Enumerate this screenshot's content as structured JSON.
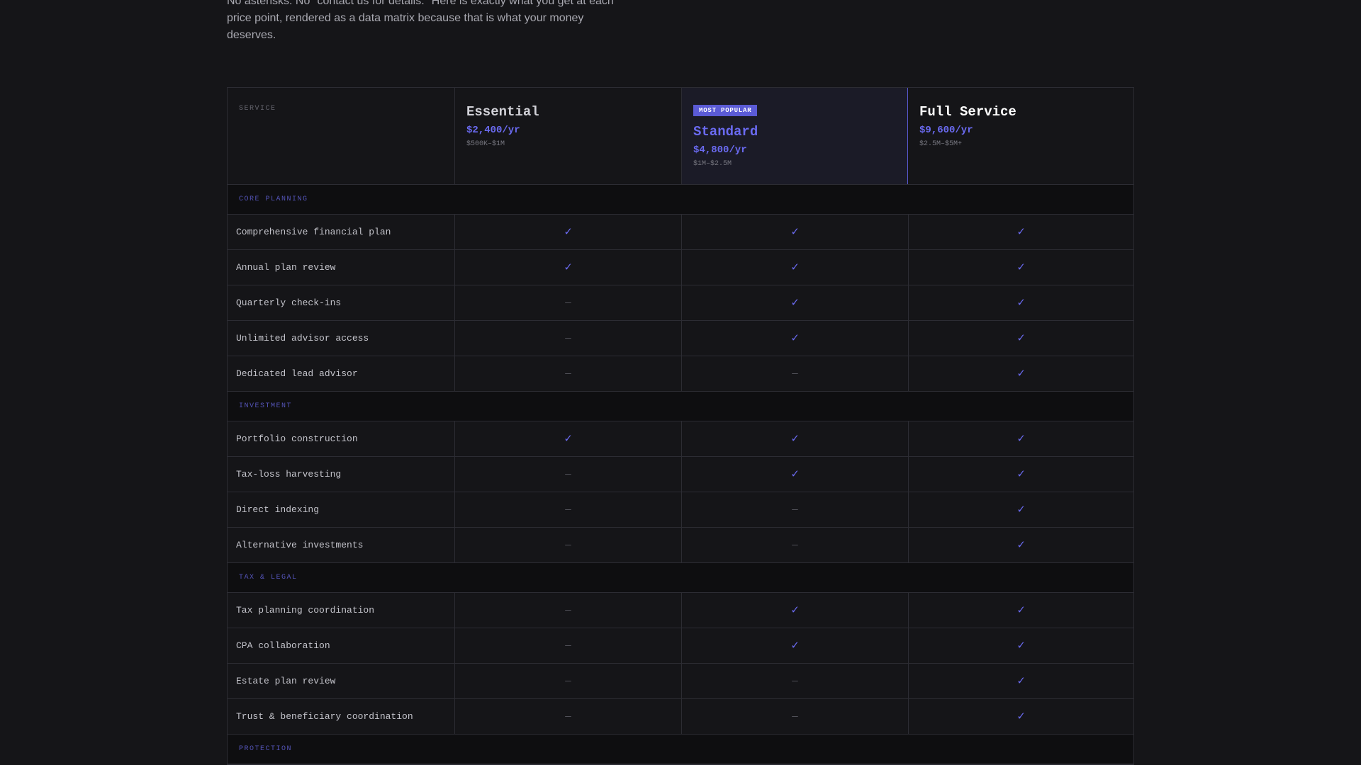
{
  "intro": {
    "text": "No asterisks. No \"contact us for details.\" Here is exactly what you get at each price point, rendered as a data matrix because that is what your money deserves."
  },
  "header": {
    "service_label": "SERVICE",
    "tiers": [
      {
        "name": "Essential",
        "price": "$2,400/yr",
        "range": "$500K–$1M"
      },
      {
        "name": "Standard",
        "price": "$4,800/yr",
        "range": "$1M–$2.5M",
        "badge": "MOST POPULAR"
      },
      {
        "name": "Full Service",
        "price": "$9,600/yr",
        "range": "$2.5M–$5M+"
      }
    ]
  },
  "marks": {
    "yes": "✓",
    "no": "—"
  },
  "colors": {
    "accent": "#5b5bd6",
    "background": "#151518",
    "section_background": "#0e0e10"
  },
  "sections": [
    {
      "label": "CORE PLANNING",
      "rows": [
        {
          "feature": "Comprehensive financial plan",
          "values": [
            true,
            true,
            true
          ]
        },
        {
          "feature": "Annual plan review",
          "values": [
            true,
            true,
            true
          ]
        },
        {
          "feature": "Quarterly check-ins",
          "values": [
            false,
            true,
            true
          ]
        },
        {
          "feature": "Unlimited advisor access",
          "values": [
            false,
            true,
            true
          ]
        },
        {
          "feature": "Dedicated lead advisor",
          "values": [
            false,
            false,
            true
          ]
        }
      ]
    },
    {
      "label": "INVESTMENT",
      "rows": [
        {
          "feature": "Portfolio construction",
          "values": [
            true,
            true,
            true
          ]
        },
        {
          "feature": "Tax-loss harvesting",
          "values": [
            false,
            true,
            true
          ]
        },
        {
          "feature": "Direct indexing",
          "values": [
            false,
            false,
            true
          ]
        },
        {
          "feature": "Alternative investments",
          "values": [
            false,
            false,
            true
          ]
        }
      ]
    },
    {
      "label": "TAX & LEGAL",
      "rows": [
        {
          "feature": "Tax planning coordination",
          "values": [
            false,
            true,
            true
          ]
        },
        {
          "feature": "CPA collaboration",
          "values": [
            false,
            true,
            true
          ]
        },
        {
          "feature": "Estate plan review",
          "values": [
            false,
            false,
            true
          ]
        },
        {
          "feature": "Trust & beneficiary coordination",
          "values": [
            false,
            false,
            true
          ]
        }
      ]
    },
    {
      "label": "PROTECTION",
      "rows": []
    }
  ]
}
